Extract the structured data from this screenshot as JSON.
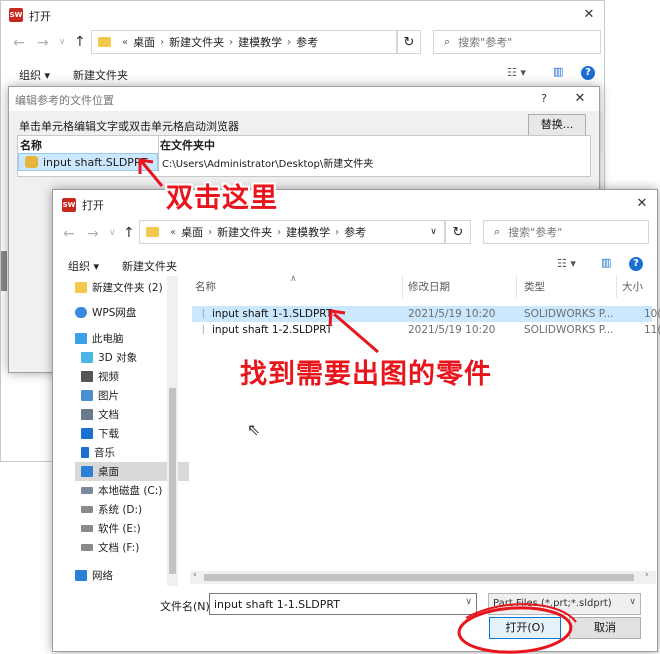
{
  "back_window": {
    "title": "打开",
    "breadcrumb": [
      "桌面",
      "新建文件夹",
      "建模教学",
      "参考"
    ],
    "search_placeholder": "搜索\"参考\"",
    "organize": "组织 ▾",
    "new_folder": "新建文件夹"
  },
  "ref_dialog": {
    "title": "编辑参考的文件位置",
    "help": "?",
    "instruction": "单击单元格编辑文字或双击单元格启动浏览器",
    "replace_button": "替换...",
    "col_name": "名称",
    "col_folder": "在文件夹中",
    "row_name": "input shaft.SLDPRT",
    "row_folder": "C:\\Users\\Administrator\\Desktop\\新建文件夹"
  },
  "front_window": {
    "title": "打开",
    "breadcrumb": [
      "桌面",
      "新建文件夹",
      "建模教学",
      "参考"
    ],
    "search_placeholder": "搜索\"参考\"",
    "organize": "组织 ▾",
    "new_folder": "新建文件夹",
    "nav": [
      {
        "label": "新建文件夹 (2)",
        "icon": "folder-icon",
        "color": "#f2c94c"
      },
      {
        "label": "WPS网盘",
        "icon": "cloud-icon",
        "color": "#3a88e0"
      },
      {
        "label": "此电脑",
        "icon": "computer-icon",
        "color": "#3aa0e8"
      },
      {
        "label": "3D 对象",
        "icon": "cube-icon",
        "color": "#4bb6e6"
      },
      {
        "label": "视频",
        "icon": "video-icon",
        "color": "#555555"
      },
      {
        "label": "图片",
        "icon": "picture-icon",
        "color": "#4a8fd0"
      },
      {
        "label": "文档",
        "icon": "document-icon",
        "color": "#6a7a8a"
      },
      {
        "label": "下载",
        "icon": "download-icon",
        "color": "#1a6fd1"
      },
      {
        "label": "音乐",
        "icon": "music-icon",
        "color": "#1a6fd1"
      },
      {
        "label": "桌面",
        "icon": "desktop-icon",
        "color": "#2a7fd6"
      },
      {
        "label": "本地磁盘 (C:)",
        "icon": "drive-icon",
        "color": "#7a8a9a"
      },
      {
        "label": "系统 (D:)",
        "icon": "drive-icon",
        "color": "#8a8a8a"
      },
      {
        "label": "软件 (E:)",
        "icon": "drive-icon",
        "color": "#8a8a8a"
      },
      {
        "label": "文档 (F:)",
        "icon": "drive-icon",
        "color": "#8a8a8a"
      },
      {
        "label": "网络",
        "icon": "network-icon",
        "color": "#2a7fd6"
      }
    ],
    "columns": [
      "名称",
      "修改日期",
      "类型",
      "大小"
    ],
    "files": [
      {
        "name": "input shaft 1-1.SLDPRT",
        "date": "2021/5/19 10:20",
        "type": "SOLIDWORKS P...",
        "size": "10("
      },
      {
        "name": "input shaft 1-2.SLDPRT",
        "date": "2021/5/19 10:20",
        "type": "SOLIDWORKS P...",
        "size": "11("
      }
    ],
    "filename_label": "文件名(N):",
    "filename_value": "input shaft 1-1.SLDPRT",
    "filetype_value": "Part Files (*.prt;*.sldprt)",
    "open_button": "打开(O)",
    "cancel_button": "取消"
  },
  "annotations": {
    "double_click": "双击这里",
    "find_part": "找到需要出图的零件"
  },
  "colors": {
    "accent": "#1a6fd1",
    "selection": "#cce8ff",
    "annotation": "#e8151c"
  }
}
